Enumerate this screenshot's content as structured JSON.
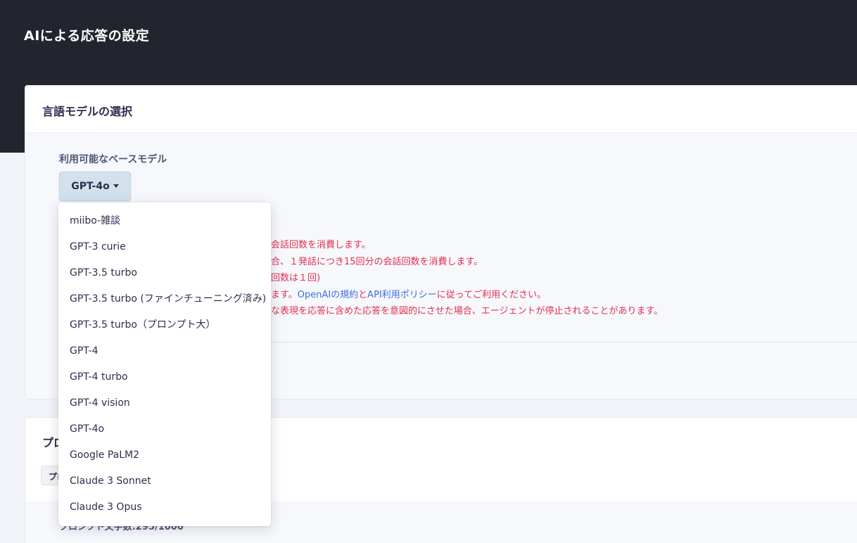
{
  "header": {
    "title": "AIによる応答の設定"
  },
  "model_card": {
    "title": "言語モデルの選択",
    "field_label": "利用可能なベースモデル",
    "selected_model": "GPT-4o",
    "notes": {
      "line1": "会話回数を消費します。",
      "line2": "合、１発話につき15回分の会話回数を消費します。",
      "line3": "回数は１回)",
      "line4_pre": "ます。",
      "line4_link1": "OpenAIの規約",
      "line4_mid": "と",
      "line4_link2": "API利用ポリシー",
      "line4_post": "に従ってご利用ください。",
      "line5": "な表現を応答に含めた応答を意図的にさせた場合、エージェントが停止されることがあります。"
    }
  },
  "prompt_card": {
    "title": "プロ",
    "chip_label": "プロ",
    "char_count": "プロンプト文字数:295/1000"
  },
  "dropdown": {
    "items": [
      {
        "label": "miibo-雑談"
      },
      {
        "label": "GPT-3 curie"
      },
      {
        "label": "GPT-3.5 turbo"
      },
      {
        "label": "GPT-3.5 turbo (ファインチューニング済み)"
      },
      {
        "label": "GPT-3.5 turbo（プロンプト大）"
      },
      {
        "label": "GPT-4"
      },
      {
        "label": "GPT-4 turbo"
      },
      {
        "label": "GPT-4 vision"
      },
      {
        "label": "GPT-4o"
      },
      {
        "label": "Google PaLM2"
      },
      {
        "label": "Claude 3 Sonnet"
      },
      {
        "label": "Claude 3 Opus"
      }
    ]
  },
  "colors": {
    "header_bg": "#22252d",
    "warning_text": "#e0304f",
    "link": "#3f6fd8",
    "selected_button_bg": "#d2e1ec"
  },
  "icons": {
    "dropdown_caret": "caret-down-icon"
  }
}
